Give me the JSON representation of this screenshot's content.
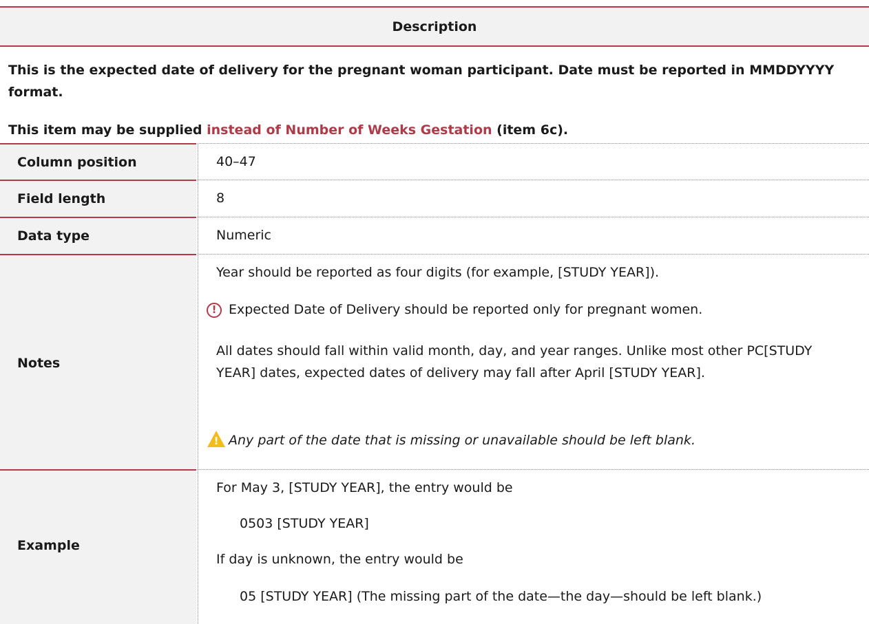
{
  "description": {
    "heading": "Description",
    "paragraph1": "This is the expected date of delivery for the pregnant woman participant. Date must be reported in MMDDYYYY format.",
    "paragraph2_pre": "This item may be supplied ",
    "paragraph2_link": "instead of Number of Weeks Gestation",
    "paragraph2_post": " (item 6c)."
  },
  "rows": {
    "column_position": {
      "label": "Column position",
      "value": "40–47"
    },
    "field_length": {
      "label": "Field length",
      "value": "8"
    },
    "data_type": {
      "label": "Data type",
      "value": "Numeric"
    },
    "notes": {
      "label": "Notes",
      "line1": "Year should be reported as four digits (for example, [STUDY YEAR]).",
      "line2": "Expected Date of Delivery should be reported only for pregnant women.",
      "line3": "All dates should fall within valid month, day, and year ranges. Unlike most other PC[STUDY YEAR] dates, expected dates of delivery may fall after April [STUDY YEAR].",
      "line4": "Any part of the date that is missing or unavailable should be left blank."
    },
    "example": {
      "label": "Example",
      "line1": "For May 3, [STUDY YEAR], the entry would be",
      "line2": "0503 [STUDY YEAR]",
      "line3": "If day is unknown, the entry would be",
      "line4": "05 [STUDY YEAR] (The missing part of the date—the day—should be left blank.)"
    }
  },
  "icons": {
    "important": "exclamation-circle-icon",
    "warning": "warning-triangle-icon"
  },
  "colors": {
    "accent": "#b03a48",
    "label_background": "#f2f2f2",
    "warning": "#f3bb1b"
  }
}
